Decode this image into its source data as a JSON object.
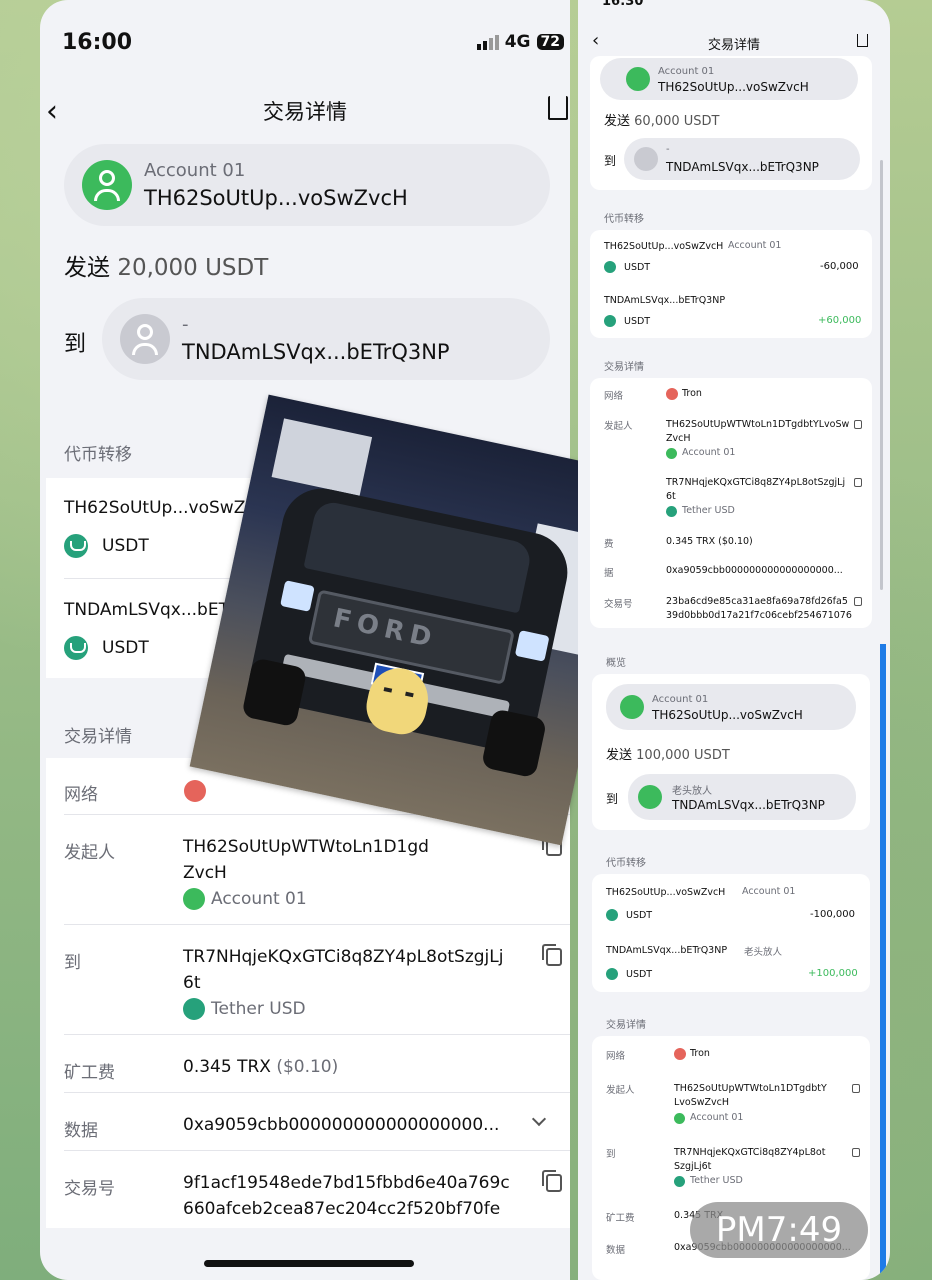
{
  "left": {
    "status_time": "16:00",
    "network": "4G",
    "battery": "72",
    "title": "交易详情",
    "from_account_name": "Account 01",
    "from_account_addr": "TH62SoUtUp...voSwZvcH",
    "send_label": "发送",
    "send_amount": "20,000 USDT",
    "to_label": "到",
    "to_name": "-",
    "to_addr": "TNDAmLSVqx...bETrQ3NP",
    "token_transfer_title": "代币转移",
    "transfers": [
      {
        "addr": "TH62SoUtUp...voSwZv",
        "token": "USDT"
      },
      {
        "addr": "TNDAmLSVqx...bET",
        "token": "USDT"
      }
    ],
    "details_title": "交易详情",
    "details": {
      "network_label": "网络",
      "initiator_label": "发起人",
      "initiator_val_1": "TH62SoUtUpWTWtoLn1D1gd",
      "initiator_val_2": "ZvcH",
      "initiator_account": "Account 01",
      "to_label": "到",
      "to_val_1": "TR7NHqjeKQxGTCi8q8ZY4pL8otSzgjLj",
      "to_val_2": "6t",
      "to_token": "Tether USD",
      "fee_label": "矿工费",
      "fee_val": "0.345 TRX",
      "fee_usd": "($0.10)",
      "data_label": "数据",
      "data_val": "0xa9059cbb000000000000000000...",
      "txid_label": "交易号",
      "txid_1": "9f1acf19548ede7bd15fbbd6e40a769c",
      "txid_2": "660afceb2cea87ec204cc2f520bf70fe"
    }
  },
  "right": {
    "status_time": "16:30",
    "title": "交易详情",
    "top": {
      "from_name": "Account 01",
      "from_addr": "TH62SoUtUp...voSwZvcH",
      "send_label": "发送",
      "send_amount": "60,000 USDT",
      "to_label": "到",
      "to_name": "-",
      "to_addr": "TNDAmLSVqx...bETrQ3NP",
      "token_title": "代币转移",
      "t1_addr": "TH62SoUtUp...voSwZvcH",
      "t1_name": "Account 01",
      "t1_token": "USDT",
      "t1_amt": "-60,000",
      "t2_addr": "TNDAmLSVqx...bETrQ3NP",
      "t2_token": "USDT",
      "t2_amt": "+60,000",
      "details_title": "交易详情",
      "network_label": "网络",
      "network_val": "Tron",
      "initiator_label": "发起人",
      "initiator_1": "TH62SoUtUpWTWtoLn1DTgdbtYLvoSw",
      "initiator_2": "ZvcH",
      "initiator_acc": "Account 01",
      "to_1": "TR7NHqjeKQxGTCi8q8ZY4pL8otSzgjLj",
      "to_2": "6t",
      "to_token": "Tether USD",
      "fee_label": "费",
      "fee": "0.345 TRX ($0.10)",
      "data_label": "据",
      "data": "0xa9059cbb000000000000000000...",
      "txid_label": "交易号",
      "txid_1": "23ba6cd9e85ca31ae8fa69a78fd26fa5",
      "txid_2": "39d0bbb0d17a21f7c06cebf254671076"
    },
    "bottom": {
      "overview_title": "概览",
      "from_name": "Account 01",
      "from_addr": "TH62SoUtUp...voSwZvcH",
      "send_label": "发送",
      "send_amount": "100,000 USDT",
      "to_label": "到",
      "to_name": "老头放人",
      "to_addr": "TNDAmLSVqx...bETrQ3NP",
      "token_title": "代币转移",
      "t1_addr": "TH62SoUtUp...voSwZvcH",
      "t1_name": "Account 01",
      "t1_token": "USDT",
      "t1_amt": "-100,000",
      "t2_addr": "TNDAmLSVqx...bETrQ3NP",
      "t2_name": "老头放人",
      "t2_token": "USDT",
      "t2_amt": "+100,000",
      "details_title": "交易详情",
      "network_label": "网络",
      "network_val": "Tron",
      "initiator_label": "发起人",
      "initiator_1": "TH62SoUtUpWTWtoLn1DTgdbtY",
      "initiator_2": "LvoSwZvcH",
      "initiator_acc": "Account 01",
      "to_1": "TR7NHqjeKQxGTCi8q8ZY4pL8ot",
      "to_2": "SzgjLj6t",
      "to_token": "Tether USD",
      "fee_label": "矿工费",
      "fee": "0.345 TRX",
      "data_label": "数据",
      "data": "0xa9059cbb000000000000000000..."
    }
  },
  "photo": {
    "grille_text": "FORD"
  },
  "timestamp_badge": "PM7:49"
}
